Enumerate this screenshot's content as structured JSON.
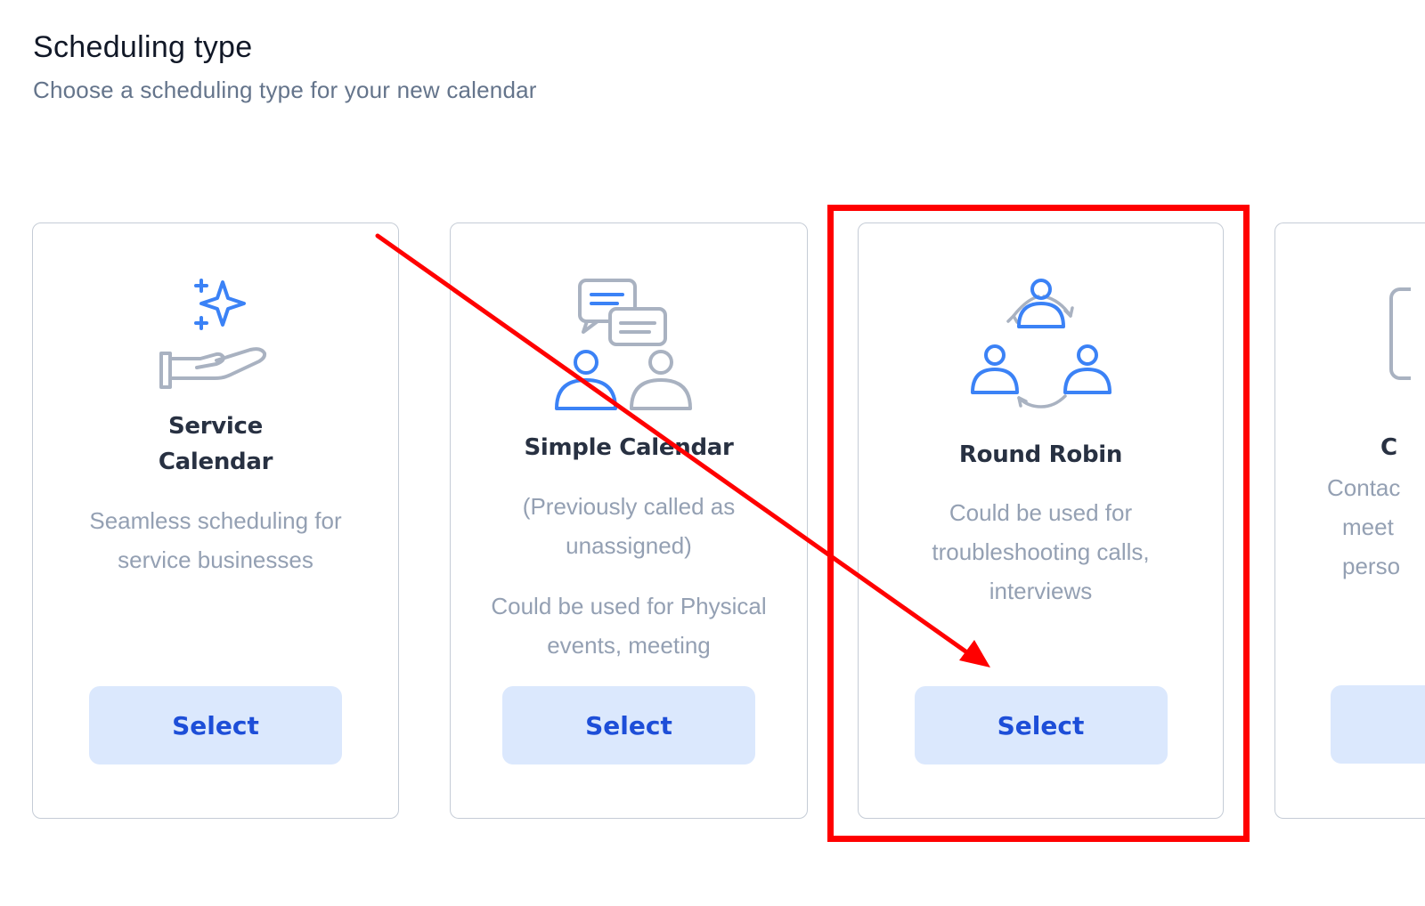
{
  "header": {
    "title": "Scheduling type",
    "subtitle": "Choose a scheduling type for your new calendar"
  },
  "cards": [
    {
      "icon": "service-hand-sparkle-icon",
      "title_lines": [
        "Service",
        "Calendar"
      ],
      "description": [
        "Seamless scheduling for",
        "service businesses"
      ],
      "button_label": "Select"
    },
    {
      "icon": "chat-people-icon",
      "title": "Simple Calendar",
      "description": [
        "(Previously called as",
        "unassigned)"
      ],
      "description2": [
        "Could be used for Physical",
        "events, meeting"
      ],
      "button_label": "Select"
    },
    {
      "icon": "round-robin-people-icon",
      "title": "Round Robin",
      "description": [
        "Could be used for",
        "troubleshooting calls,",
        "interviews"
      ],
      "button_label": "Select"
    },
    {
      "icon": "partial-card-icon",
      "title_partial": "C",
      "description_partial": [
        "Contac",
        "meet",
        "perso"
      ]
    }
  ],
  "annotation": {
    "highlight_color": "#ff0000",
    "arrow_color": "#ff0000"
  },
  "colors": {
    "accent": "#1d4ed8",
    "button_bg": "#dbe8fd",
    "icon_blue": "#3b82f6",
    "icon_gray": "#a9b2c1"
  }
}
